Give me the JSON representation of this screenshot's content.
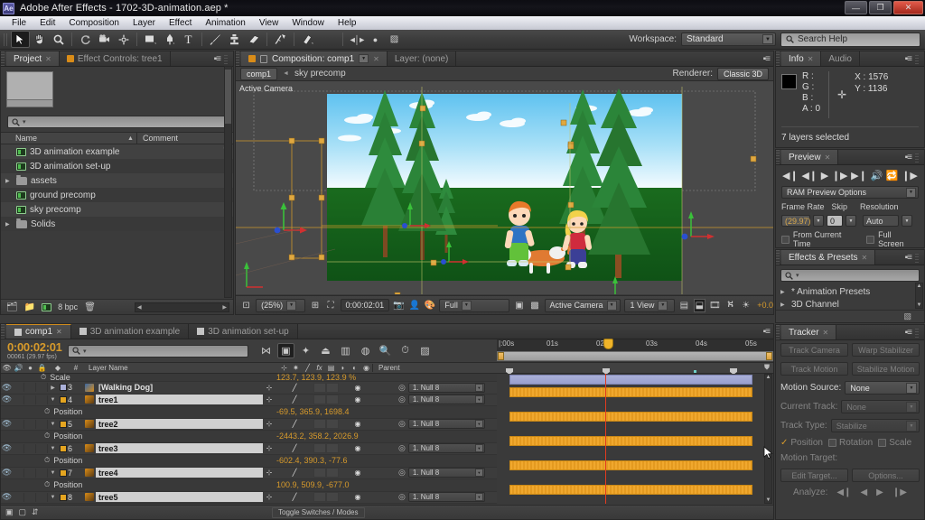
{
  "window": {
    "app_name": "Adobe After Effects",
    "title": "Adobe After Effects - 1702-3D-animation.aep *",
    "logo_text": "Ae",
    "minimize": "—",
    "maximize": "❐",
    "close": "✕"
  },
  "menubar": {
    "items": [
      "File",
      "Edit",
      "Composition",
      "Layer",
      "Effect",
      "Animation",
      "View",
      "Window",
      "Help"
    ]
  },
  "toolbar": {
    "tools": [
      {
        "name": "selection-tool",
        "glyph": "➤",
        "selected": true
      },
      {
        "name": "hand-tool",
        "glyph": "✋",
        "selected": false
      },
      {
        "name": "zoom-tool",
        "glyph": "🔍",
        "selected": false
      },
      {
        "name": "rotation-tool",
        "glyph": "↻",
        "selected": false
      },
      {
        "name": "camera-tool",
        "glyph": "🎥",
        "selected": false
      },
      {
        "name": "pan-behind-tool",
        "glyph": "✛",
        "selected": false
      },
      {
        "name": "shape-tool",
        "glyph": "▬",
        "selected": false
      },
      {
        "name": "pen-tool",
        "glyph": "✒",
        "selected": false
      },
      {
        "name": "type-tool",
        "glyph": "T",
        "selected": false
      },
      {
        "name": "brush-tool",
        "glyph": "✎",
        "selected": false
      },
      {
        "name": "clone-stamp-tool",
        "glyph": "⚘",
        "selected": false
      },
      {
        "name": "eraser-tool",
        "glyph": "◗",
        "selected": false
      },
      {
        "name": "roto-brush-tool",
        "glyph": "✦",
        "selected": false
      },
      {
        "name": "puppet-pin-tool",
        "glyph": "📌",
        "selected": false
      }
    ],
    "extra_icons": [
      {
        "name": "local-axis-mode-icon",
        "glyph": "◄►"
      },
      {
        "name": "world-axis-mode-icon",
        "glyph": "●"
      },
      {
        "name": "view-axis-mode-icon",
        "glyph": "▨"
      }
    ],
    "workspace_label": "Workspace:",
    "workspace_value": "Standard",
    "search_placeholder": "Search Help"
  },
  "project_panel": {
    "tabs": [
      {
        "label": "Project",
        "active": true,
        "closable": true
      },
      {
        "label": "Effect Controls: tree1",
        "active": false,
        "closable": false
      }
    ],
    "search_placeholder": "",
    "columns": {
      "name": "Name",
      "comment": "Comment"
    },
    "items": [
      {
        "label": "3D animation example",
        "type": "comp",
        "expandable": false
      },
      {
        "label": "3D animation set-up",
        "type": "comp",
        "expandable": false
      },
      {
        "label": "assets",
        "type": "folder",
        "expandable": true
      },
      {
        "label": "ground precomp",
        "type": "comp",
        "expandable": false
      },
      {
        "label": "sky precomp",
        "type": "comp",
        "expandable": false
      },
      {
        "label": "Solids",
        "type": "folder",
        "expandable": true
      }
    ],
    "footer": {
      "bit_depth": "8 bpc",
      "icons": [
        "new-composition-icon",
        "new-folder-icon",
        "project-settings-icon",
        "delete-icon"
      ]
    }
  },
  "comp_panel": {
    "tabs": [
      {
        "label": "Composition: comp1",
        "active": true
      },
      {
        "label": "Layer: (none)",
        "active": false
      }
    ],
    "breadcrumb_button": "comp1",
    "breadcrumb_text": "sky precomp",
    "renderer_label": "Renderer:",
    "renderer_value": "Classic 3D",
    "view_label": "Active Camera",
    "footer": {
      "zoom": "(25%)",
      "time": "0:00:02:01",
      "resolution": "Full",
      "camera": "Active Camera",
      "views": "1 View",
      "exposure": "+0.0"
    }
  },
  "info_panel": {
    "tabs": [
      {
        "label": "Info",
        "active": true
      },
      {
        "label": "Audio",
        "active": false
      }
    ],
    "channels": [
      "R :",
      "G :",
      "B :",
      "A : 0"
    ],
    "x": "X : 1576",
    "y": "Y : 1136",
    "status": "7 layers selected"
  },
  "preview_panel": {
    "tab": "Preview",
    "transport": [
      "first-frame-icon",
      "prev-frame-icon",
      "play-icon",
      "next-frame-icon",
      "last-frame-icon",
      "audio-icon",
      "loop-icon",
      "ram-preview-icon"
    ],
    "options_label": "RAM Preview Options",
    "frame_rate_label": "Frame Rate",
    "frame_rate_value": "(29.97)",
    "skip_label": "Skip",
    "skip_value": "0",
    "resolution_label": "Resolution",
    "resolution_value": "Auto",
    "from_current_time": "From Current Time",
    "full_screen": "Full Screen"
  },
  "effects_panel": {
    "tab": "Effects & Presets",
    "search_placeholder": "",
    "items": [
      "* Animation Presets",
      "3D Channel"
    ]
  },
  "tracker_panel": {
    "tab": "Tracker",
    "buttons": [
      "Track Camera",
      "Warp Stabilizer",
      "Track Motion",
      "Stabilize Motion"
    ],
    "motion_source_label": "Motion Source:",
    "motion_source_value": "None",
    "current_track_label": "Current Track:",
    "current_track_value": "None",
    "track_type_label": "Track Type:",
    "track_type_value": "Stabilize",
    "checkboxes": [
      {
        "label": "Position",
        "checked": true
      },
      {
        "label": "Rotation",
        "checked": false
      },
      {
        "label": "Scale",
        "checked": false
      }
    ],
    "motion_target_label": "Motion Target:",
    "edit_target": "Edit Target...",
    "options": "Options...",
    "analyze_label": "Analyze:"
  },
  "timeline": {
    "tabs": [
      {
        "label": "comp1",
        "active": true
      },
      {
        "label": "3D animation example",
        "active": false
      },
      {
        "label": "3D animation set-up",
        "active": false
      }
    ],
    "current_time": "0:00:02:01",
    "frame_info": "00061 (29.97 fps)",
    "search_placeholder": "",
    "tools": [
      {
        "name": "composition-mini-flowchart-icon",
        "on": false
      },
      {
        "name": "draft-3d-icon",
        "on": true
      },
      {
        "name": "hide-shy-layers-icon",
        "on": false
      },
      {
        "name": "enable-frame-blending-icon",
        "on": false
      },
      {
        "name": "enable-motion-blur-icon",
        "on": false
      },
      {
        "name": "graph-editor-icon",
        "on": false
      },
      {
        "name": "brainstorm-icon",
        "on": false
      },
      {
        "name": "auto-keyframe-icon",
        "on": false
      },
      {
        "name": "motion-blur-icon",
        "on": false
      }
    ],
    "column_headers": {
      "layer_name": "Layer Name",
      "parent": "Parent",
      "switch_icons": [
        "audio-icon",
        "solo-icon",
        "lock-icon",
        "shy-icon",
        "effects-icon",
        "collapse-icon",
        "quality-icon",
        "motion-blur-icon",
        "adjustment-icon",
        "3d-layer-icon"
      ]
    },
    "ruler_ticks": [
      "|:00s",
      "01s",
      "02s",
      "03s",
      "04s",
      "05s"
    ],
    "toggle_switches_label": "Toggle Switches / Modes",
    "layers": [
      {
        "index": "",
        "name": "Scale",
        "kind": "prop-partial",
        "value": "123.7, 123.9, 123.9 %",
        "parent": "",
        "color": ""
      },
      {
        "index": "3",
        "name": "[Walking Dog]",
        "kind": "layer",
        "color": "#aab0d8",
        "parent": "1. Null 8",
        "expanded": false,
        "selected": false,
        "bar": "audio"
      },
      {
        "index": "4",
        "name": "tree1",
        "kind": "layer",
        "color": "#e5a520",
        "parent": "1. Null 8",
        "expanded": true,
        "selected": true,
        "bar": "orange"
      },
      {
        "index": "",
        "name": "Position",
        "kind": "prop",
        "value": "-69.5, 365.9, 1698.4",
        "parent": ""
      },
      {
        "index": "5",
        "name": "tree2",
        "kind": "layer",
        "color": "#e5a520",
        "parent": "1. Null 8",
        "expanded": true,
        "selected": true,
        "bar": "orange"
      },
      {
        "index": "",
        "name": "Position",
        "kind": "prop",
        "value": "-2443.2, 358.2, 2026.9",
        "parent": ""
      },
      {
        "index": "6",
        "name": "tree3",
        "kind": "layer",
        "color": "#e5a520",
        "parent": "1. Null 8",
        "expanded": true,
        "selected": true,
        "bar": "orange"
      },
      {
        "index": "",
        "name": "Position",
        "kind": "prop",
        "value": "-602.4, 390.3, -77.6",
        "parent": ""
      },
      {
        "index": "7",
        "name": "tree4",
        "kind": "layer",
        "color": "#e5a520",
        "parent": "1. Null 8",
        "expanded": true,
        "selected": true,
        "bar": "orange"
      },
      {
        "index": "",
        "name": "Position",
        "kind": "prop",
        "value": "100.9, 509.9, -677.0",
        "parent": ""
      },
      {
        "index": "8",
        "name": "tree5",
        "kind": "layer",
        "color": "#e5a520",
        "parent": "1. Null 8",
        "expanded": true,
        "selected": true,
        "bar": "orange"
      }
    ]
  },
  "colors": {
    "accent_orange": "#d79a2b",
    "bar_orange": "#e9a227",
    "playhead_red": "#e23b20",
    "panel_bg": "#3b3b3b",
    "sky_blue": "#7ec8f0",
    "ground_green": "#1f7a1f",
    "tree_green": "#2e8b3d"
  }
}
